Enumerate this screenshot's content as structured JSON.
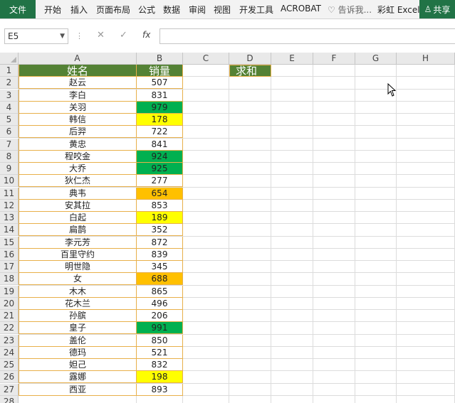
{
  "ribbon": {
    "file": "文件",
    "tabs": [
      "开始",
      "插入",
      "页面布局",
      "公式",
      "数据",
      "审阅",
      "视图",
      "开发工具",
      "ACROBAT"
    ],
    "tell_me": "告诉我...",
    "user": "彩虹 Excel",
    "share": "共享"
  },
  "formula_bar": {
    "name_box": "E5",
    "value": ""
  },
  "columns": [
    "A",
    "B",
    "C",
    "D",
    "E",
    "F",
    "G",
    "H"
  ],
  "header": {
    "name": "姓名",
    "sales": "销量",
    "sum_label": "求和"
  },
  "rows": [
    {
      "name": "赵云",
      "sales": "507",
      "fill": ""
    },
    {
      "name": "李白",
      "sales": "831",
      "fill": ""
    },
    {
      "name": "关羽",
      "sales": "979",
      "fill": "#00b050"
    },
    {
      "name": "韩信",
      "sales": "178",
      "fill": "#ffff00"
    },
    {
      "name": "后羿",
      "sales": "722",
      "fill": ""
    },
    {
      "name": "黄忠",
      "sales": "841",
      "fill": ""
    },
    {
      "name": "程咬金",
      "sales": "924",
      "fill": "#00b050"
    },
    {
      "name": "大乔",
      "sales": "925",
      "fill": "#00b050"
    },
    {
      "name": "狄仁杰",
      "sales": "277",
      "fill": ""
    },
    {
      "name": "典韦",
      "sales": "654",
      "fill": "#ffc000"
    },
    {
      "name": "安其拉",
      "sales": "853",
      "fill": ""
    },
    {
      "name": "白起",
      "sales": "189",
      "fill": "#ffff00"
    },
    {
      "name": "扁鹊",
      "sales": "352",
      "fill": ""
    },
    {
      "name": "李元芳",
      "sales": "872",
      "fill": ""
    },
    {
      "name": "百里守约",
      "sales": "839",
      "fill": ""
    },
    {
      "name": "明世隐",
      "sales": "345",
      "fill": ""
    },
    {
      "name": "女",
      "sales": "688",
      "fill": "#ffc000"
    },
    {
      "name": "木木",
      "sales": "865",
      "fill": ""
    },
    {
      "name": "花木兰",
      "sales": "496",
      "fill": ""
    },
    {
      "name": "孙膑",
      "sales": "206",
      "fill": ""
    },
    {
      "name": "皇子",
      "sales": "991",
      "fill": "#00b050"
    },
    {
      "name": "盖伦",
      "sales": "850",
      "fill": ""
    },
    {
      "name": "德玛",
      "sales": "521",
      "fill": ""
    },
    {
      "name": "妲己",
      "sales": "832",
      "fill": ""
    },
    {
      "name": "露娜",
      "sales": "198",
      "fill": "#ffff00"
    },
    {
      "name": "西亚",
      "sales": "893",
      "fill": ""
    }
  ],
  "theme": {
    "accent": "#217346",
    "header_fill": "#548235",
    "border": "#e8b04a"
  }
}
